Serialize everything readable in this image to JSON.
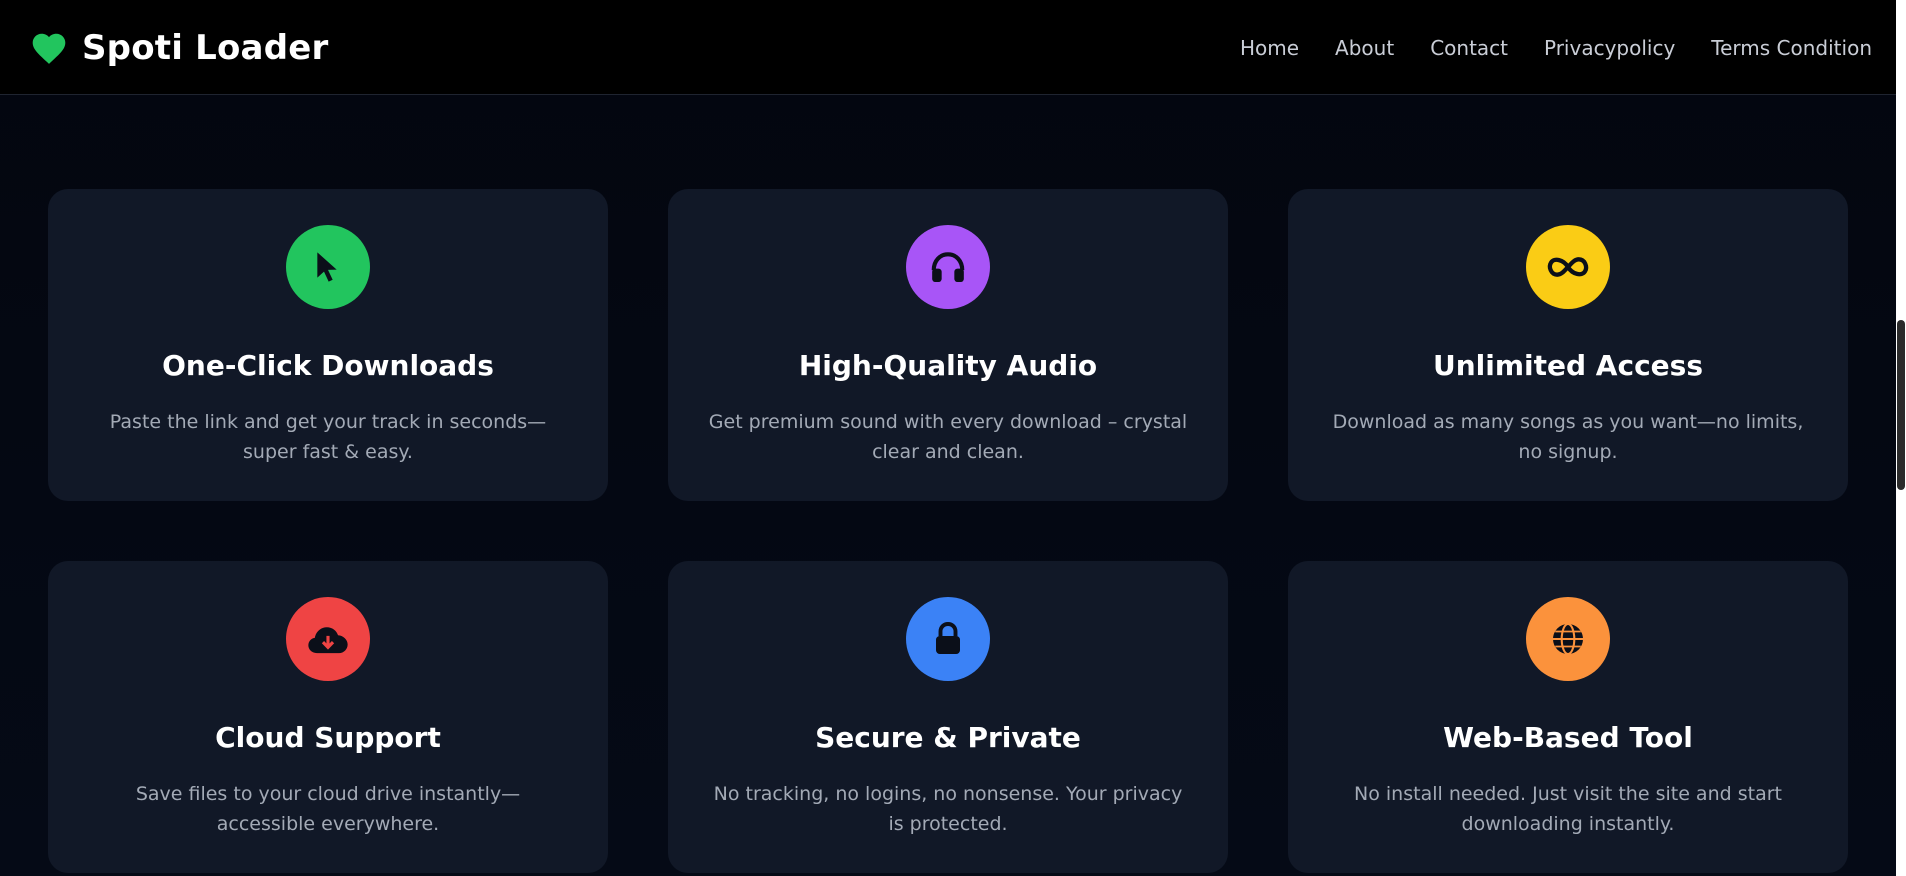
{
  "header": {
    "brand": "Spoti Loader",
    "nav": [
      "Home",
      "About",
      "Contact",
      "Privacypolicy",
      "Terms Condition"
    ]
  },
  "features": [
    {
      "icon": "cursor-icon",
      "color": "#22c55e",
      "title": "One-Click Downloads",
      "description": "Paste the link and get your track in seconds—super fast & easy."
    },
    {
      "icon": "headphones-icon",
      "color": "#a855f7",
      "title": "High-Quality Audio",
      "description": "Get premium sound with every download – crystal clear and clean."
    },
    {
      "icon": "infinity-icon",
      "color": "#facc15",
      "title": "Unlimited Access",
      "description": "Download as many songs as you want—no limits, no signup."
    },
    {
      "icon": "cloud-download-icon",
      "color": "#ef4444",
      "title": "Cloud Support",
      "description": "Save files to your cloud drive instantly—accessible everywhere."
    },
    {
      "icon": "lock-icon",
      "color": "#3b82f6",
      "title": "Secure & Private",
      "description": "No tracking, no logins, no nonsense. Your privacy is protected."
    },
    {
      "icon": "globe-icon",
      "color": "#fb923c",
      "title": "Web-Based Tool",
      "description": "No install needed. Just visit the site and start downloading instantly."
    }
  ]
}
